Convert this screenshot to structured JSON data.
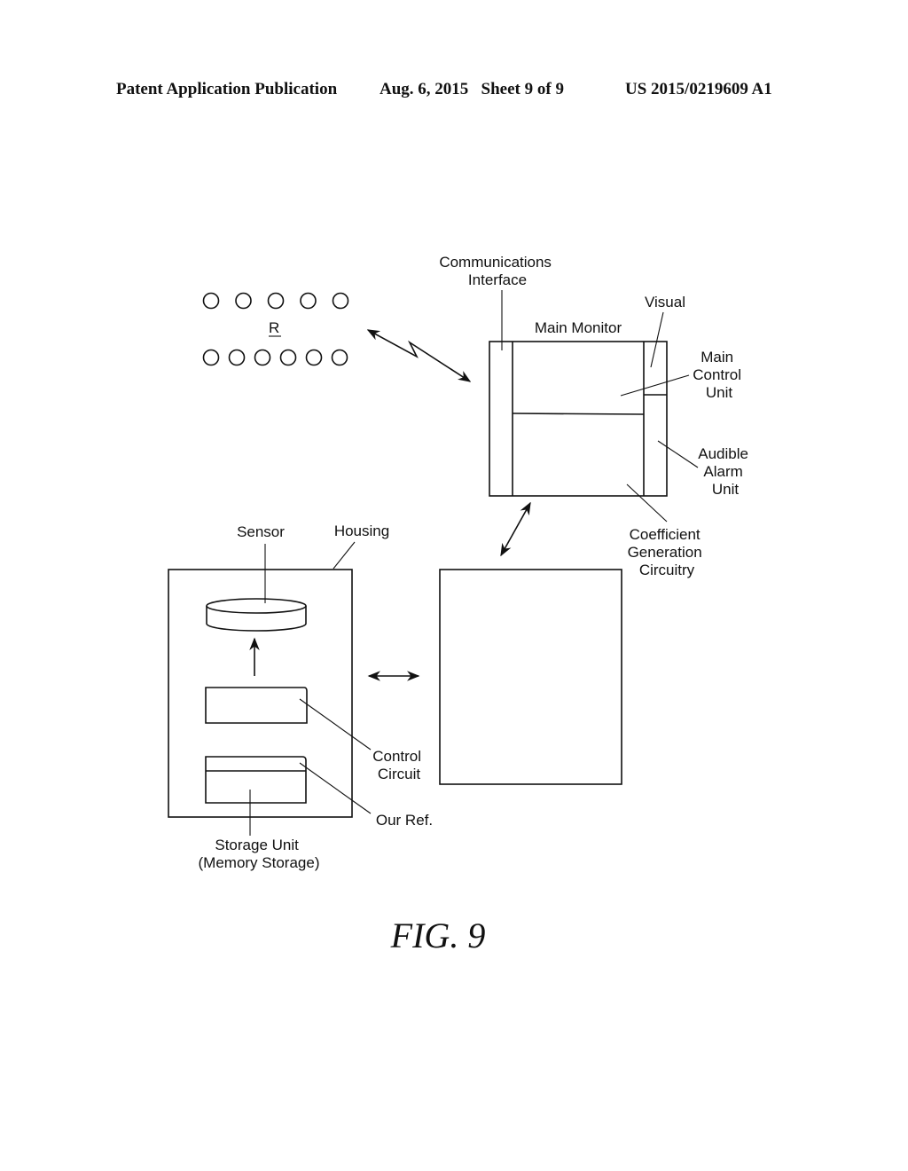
{
  "header": {
    "publication": "Patent Application Publication",
    "date_sheet": "Aug. 6, 2015   Sheet 9 of 9",
    "number": "US 2015/0219609 A1"
  },
  "diagram": {
    "remote_cluster_label": "R",
    "remote_top_row_count": 5,
    "remote_bottom_row_count": 6,
    "labels": {
      "communications_interface": [
        "Communications",
        "Interface"
      ],
      "main_monitor": "Main Monitor",
      "visual": "Visual",
      "main_control_unit": [
        "Main",
        "Control",
        "Unit"
      ],
      "audible_alarm_unit": [
        "Audible",
        "Alarm",
        "Unit"
      ],
      "coefficient_generation": [
        "Coefficient",
        "Generation",
        "Circuitry"
      ],
      "sensor": "Sensor",
      "housing": "Housing",
      "control_circuit": [
        "Control",
        "Circuit"
      ],
      "our_ref": "Our Ref.",
      "storage_unit": [
        "Storage Unit",
        "(Memory Storage)"
      ]
    },
    "figure_caption": "FIG. 9"
  }
}
